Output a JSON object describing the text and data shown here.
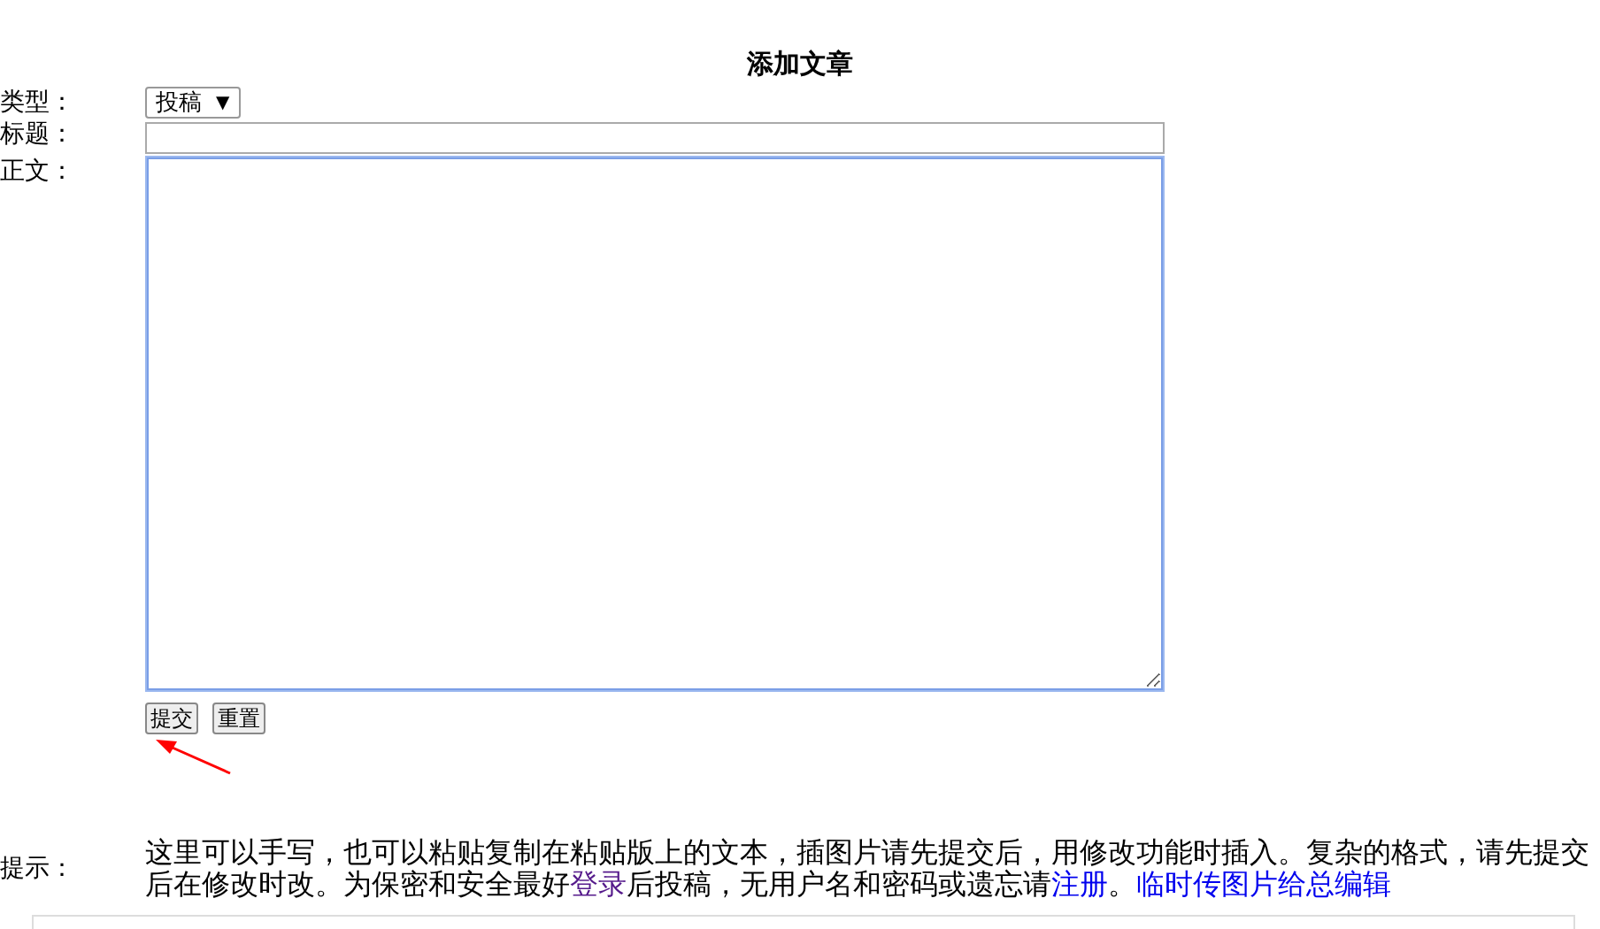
{
  "heading": "添加文章",
  "fields": [
    {
      "label": "类型：",
      "kind": "select",
      "value": "投稿",
      "caret": "▼"
    },
    {
      "label": "标题：",
      "kind": "input"
    },
    {
      "label": "正文：",
      "kind": "textarea",
      "focused": true
    }
  ],
  "buttons": [
    "提交",
    "重置"
  ],
  "hint": {
    "label": "提示：",
    "parts": [
      {
        "kind": "text",
        "text": "这里可以手写，也可以粘贴复制在粘贴版上的文本，插图片请先提交后，用修改功能时插入。复杂的格式，请先提交后在修改时改。为保密和安全最好"
      },
      {
        "kind": "link",
        "text": "登录",
        "visited": true
      },
      {
        "kind": "text",
        "text": "后投稿，无用户名和密码或遗忘请"
      },
      {
        "kind": "link",
        "text": "注册",
        "visited": false
      },
      {
        "kind": "text",
        "text": "。"
      },
      {
        "kind": "link",
        "text": "临时传图片给总编辑",
        "visited": false
      }
    ]
  }
}
